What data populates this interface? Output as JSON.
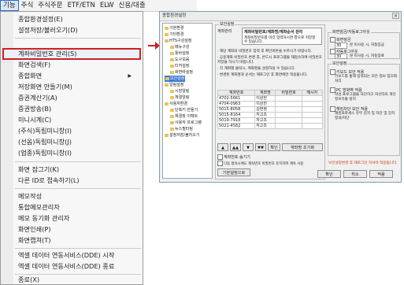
{
  "menubar": {
    "items": [
      "기능",
      "주식",
      "주식주문",
      "ETF/ETN",
      "ELW",
      "신용/대출"
    ]
  },
  "menu": {
    "items": [
      "종합환경설정(E)",
      "설정저장/불러오기(D)",
      "계좌비밀번호 관리(S)",
      "화면검색(F)",
      "종합화면",
      "저장화면 만들기(M)",
      "증권계산기(A)",
      "증권방송(B)",
      "미니시계(C)",
      "(주식)독립미니창(I)",
      "(선옵)독립미니창(J)",
      "(업종)독립미니창(I)",
      "화면 잠그기(K)",
      "다른 ID로 접속하기(L)",
      "메모작성",
      "통합메모관리자",
      "메모 동기화 관리자",
      "화면인쇄(P)",
      "화면캡쳐(T)",
      "엑셀 데이터 연동서비스(DDE) 시작",
      "엑셀 데이터 연동서비스(DDE) 종료",
      "종료(X)"
    ],
    "submenu_arrow": "▶"
  },
  "dialog": {
    "title": "종합환경설정",
    "close": "×",
    "tree": [
      "기본환경",
      "기타환경",
      "HTS구성설정",
      "메뉴구성",
      "툴바설정",
      "도구모음",
      "티커설정",
      "화면바설정",
      "보안설정",
      "알림설정",
      "시장알림",
      "체결알림",
      "사용자환경",
      "단축키 만들기",
      "체결창 이펙트",
      "사용자 프로그램",
      "뉴스필터링",
      "설정저장/불러오기"
    ],
    "tree_selected": "보안설정",
    "account": {
      "group_title": "보안설정",
      "sub_title": "계좌관리",
      "header_box": "계좌비밀번호/계좌명/계좌순서 관리",
      "header_sub": "계좌비밀번호를 미리 입력하시면 창으로 저장할 수 있습니다.",
      "notes": [
        "· 해당 계좌의 비밀번호 입력 후 확인버튼을 누르시기 바랍니다.",
        "· 공용계좌 비밀번호 변경 후, 반드시 프로그램을 재접속하여 비밀번호 저장을 하시기 바랍니다.",
        "· 각 계좌별 클릭시, 계좌명을 설정하실 수 있습니다.",
        "· 변경된 계좌명과 순서는 재로그인 후 화면에만 적용됩니다."
      ],
      "columns": [
        "계좌번호",
        "계좌명",
        "비밀번호",
        "메시지"
      ],
      "rows": [
        [
          "4702-5661",
          "이상헌",
          "",
          ""
        ],
        [
          "4704-0963",
          "이상헌",
          "",
          ""
        ],
        [
          "5015-8058",
          "김현정",
          "",
          ""
        ],
        [
          "5015-8164",
          "자고조",
          "",
          ""
        ],
        [
          "5019-7918",
          "자고조",
          "",
          ""
        ],
        [
          "5021-4582",
          "자고조",
          "",
          ""
        ]
      ],
      "nav": [
        "▲",
        "▲▲",
        "▼",
        "▼▼"
      ],
      "confirm": "확인",
      "reset": "계좌명 초기화",
      "opt1": "계좌번호 숨기기",
      "opt2": "다음 접속시에도 계좌번호 비밀번호 유지하여 계속 사용",
      "restore": "기본설정으로"
    },
    "right": {
      "autologout_title": "화면잠금/자동로그아웃",
      "lock_label": "화면잠금",
      "lock_value": "30",
      "lock_suffix": "분 미사용 시, 자동잠금",
      "logout_label": "자동로그아웃",
      "logout_value": "30",
      "logout_suffix": "분 미사용 시, 자동종료",
      "security_title": "보안설정",
      "security_items": [
        "키보드 보안 적용",
        "키보드를 통해 입력되는 모든 정보 암호화 처리",
        "PC 방화벽 적용",
        "악성 프로그램을 차단하고 자신타의 개인정보유출 방지",
        "해킹차단 보안 적용",
        "해킹프로세스 유무 감지 및 차단 및 장치 정의/차단"
      ],
      "notice": "보안설정변경 후 재로그인 하셔야 적용됩니다."
    },
    "buttons": [
      "확인",
      "취소",
      "적용"
    ]
  },
  "colors": {
    "accent_red": "#d02020",
    "selection_blue": "#3d7bd5",
    "notice_red": "#c83a1a"
  }
}
